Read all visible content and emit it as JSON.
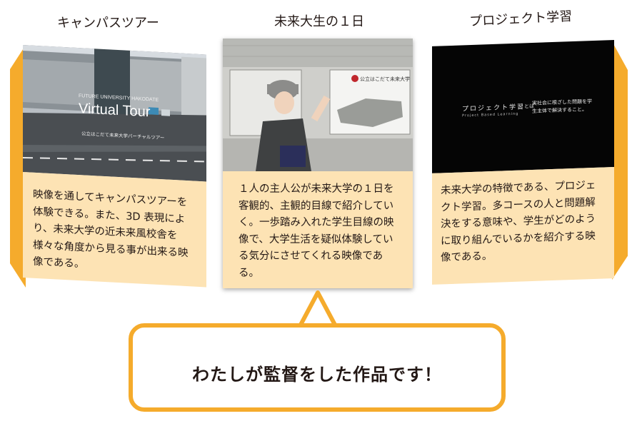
{
  "cards": [
    {
      "title": "キャンパスツアー",
      "image_caption_top": "FUTURE UNIVERSITY HAKODATE",
      "image_caption_main": "Virtual Tour",
      "image_caption_sub": "公立はこだて未来大学バーチャルツアー",
      "description": "映像を通してキャンパスツアーを体験できる。また、3D 表現により、未来大学の近未来風校舎を様々な角度から見る事が出来る映像である。"
    },
    {
      "title": "未来大生の１日",
      "image_sign_text": "公立はこだて未来大学",
      "description": "１人の主人公が未来大学の１日を客観的、主観的目線で紹介していく。一歩踏み入れた学生目線の映像で、大学生活を疑似体験している気分にさせてくれる映像である。"
    },
    {
      "title": "プロジェクト学習",
      "image_caption_main": "プロジェクト学習",
      "image_caption_sub": "Project Based Learning",
      "image_caption_toha": "とは",
      "image_caption_desc": "実社会に根ざした問題を学生主体で解決すること。",
      "description": "未来大学の特徴である、プロジェクト学習。多コースの人と問題解決をする意味や、学生がどのように取り組んでいるかを紹介する映像である。"
    }
  ],
  "bubble": {
    "text": "わたしが監督をした作品です！"
  },
  "colors": {
    "accent": "#f5ab2c",
    "card_bg": "#fde3b4",
    "text": "#231815"
  }
}
